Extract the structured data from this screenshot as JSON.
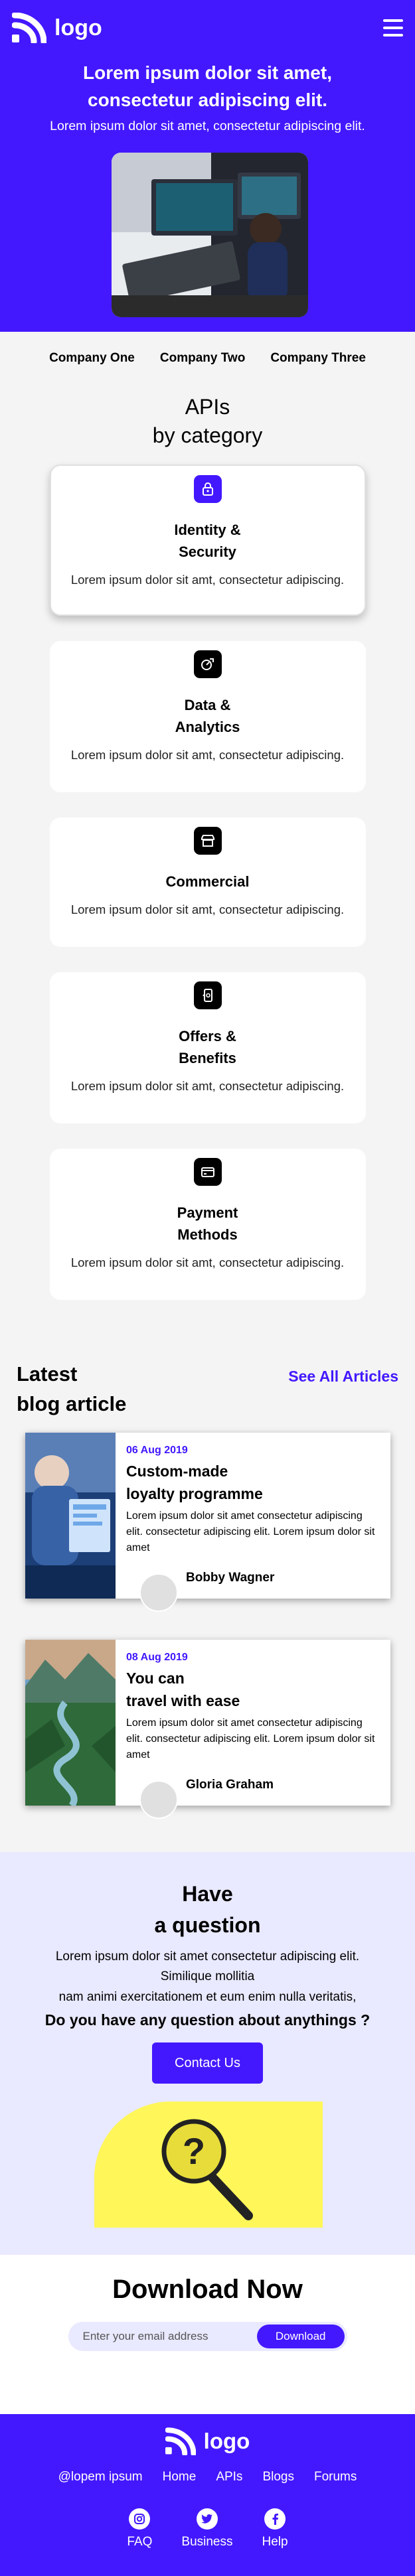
{
  "header": {
    "logo_text": "logo",
    "menu_icon": "hamburger-menu-icon",
    "title": "Lorem ipsum dolor sit amet, consectetur adipiscing elit.",
    "subtitle": "Lorem ipsum dolor sit amet, consectetur adipiscing elit."
  },
  "companies": [
    "Company One",
    "Company Two",
    "Company Three"
  ],
  "apis": {
    "heading_line1": "APIs",
    "heading_line2": "by category",
    "cards": [
      {
        "icon": "lock-icon",
        "title": "Identity &\nSecurity",
        "desc": "Lorem ipsum dolor sit amt, consectetur adipiscing."
      },
      {
        "icon": "analytics-icon",
        "title": "Data &\nAnalytics",
        "desc": "Lorem ipsum dolor sit amt, consectetur adipiscing."
      },
      {
        "icon": "store-icon",
        "title": "Commercial",
        "desc": "Lorem ipsum dolor sit amt, consectetur adipiscing."
      },
      {
        "icon": "mobile-offer-icon",
        "title": "Offers &\nBenefits",
        "desc": "Lorem ipsum dolor sit amt, consectetur adipiscing."
      },
      {
        "icon": "card-payment-icon",
        "title": "Payment\nMethods",
        "desc": "Lorem ipsum dolor sit amt, consectetur adipiscing."
      }
    ]
  },
  "blog": {
    "heading": "Latest\nblog article",
    "see_all": "See All Articles",
    "posts": [
      {
        "date": "06 Aug 2019",
        "title": "Custom-made\nloyalty programme",
        "text": "Lorem ipsum dolor sit amet consectetur adipiscing elit. consectetur adipiscing elit. Lorem ipsum dolor sit amet",
        "author": "Bobby Wagner"
      },
      {
        "date": "08 Aug 2019",
        "title": "You can\ntravel with ease",
        "text": "Lorem ipsum dolor sit amet consectetur adipiscing elit. consectetur adipiscing elit. Lorem ipsum dolor sit amet",
        "author": "Gloria Graham"
      }
    ]
  },
  "question": {
    "title": "Have\na question",
    "text_line1": "Lorem ipsum dolor sit amet consectetur adipiscing elit.",
    "text_line2": "Similique mollitia",
    "text_line3": "nam animi exercitationem et eum enim nulla veritatis,",
    "ask": "Do you have any question about anythings ?",
    "button": "Contact Us"
  },
  "download": {
    "title_bold": "Download",
    "title_rest": " Now",
    "placeholder": "Enter your email address",
    "button": "Download"
  },
  "footer": {
    "logo_text": "logo",
    "links": [
      "@lopem ipsum",
      "Home",
      "APIs",
      "Blogs",
      "Forums"
    ],
    "social": [
      {
        "icon": "instagram-icon",
        "label": "FAQ"
      },
      {
        "icon": "twitter-icon",
        "label": "Business"
      },
      {
        "icon": "facebook-icon",
        "label": "Help"
      }
    ]
  },
  "colors": {
    "brand": "#4318ff",
    "light_bg": "#e9e9ff",
    "accent_yellow": "#fff65a"
  }
}
